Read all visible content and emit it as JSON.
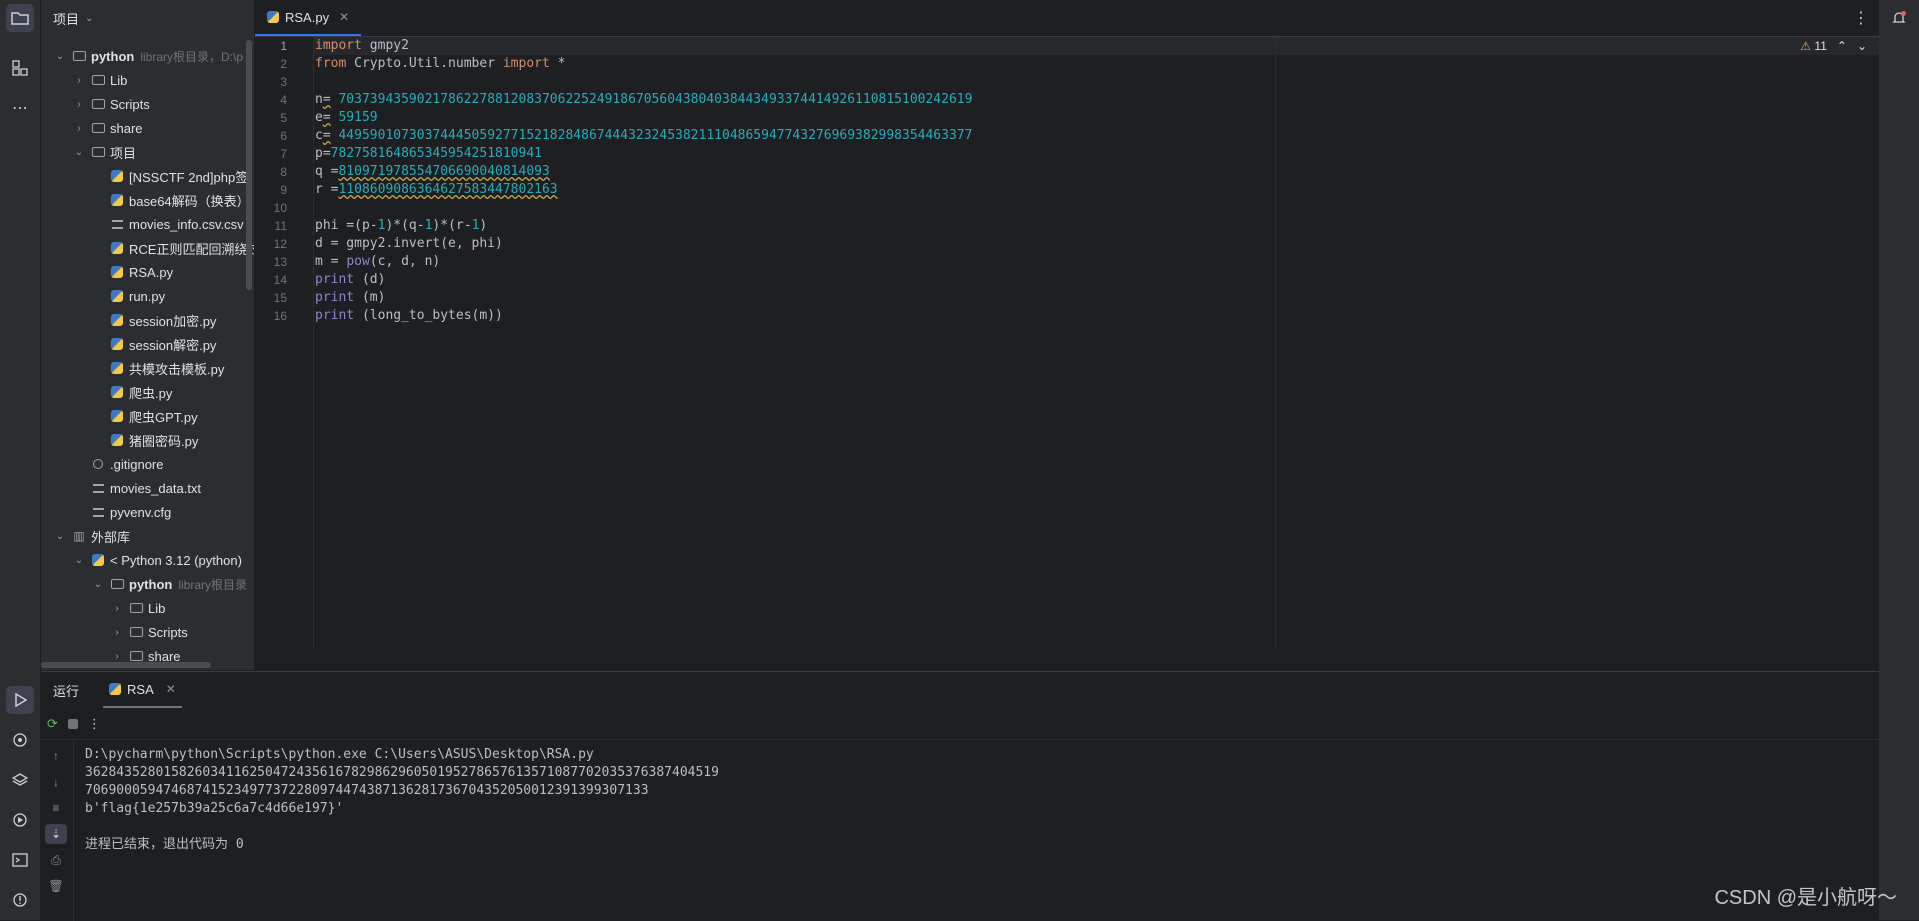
{
  "project_panel": {
    "title": "项目",
    "tree": [
      {
        "label": "python",
        "hint": "library根目录，D:\\p",
        "icon": "folder-icon",
        "arrow": "⌄",
        "bold": true
      },
      {
        "label": "Lib",
        "icon": "folder-icon",
        "arrow": "›"
      },
      {
        "label": "Scripts",
        "icon": "folder-icon",
        "arrow": "›"
      },
      {
        "label": "share",
        "icon": "folder-icon",
        "arrow": "›"
      },
      {
        "label": "项目",
        "icon": "folder-icon",
        "arrow": "⌄"
      },
      {
        "label": "[NSSCTF 2nd]php签",
        "icon": "python-file-icon"
      },
      {
        "label": "base64解码（换表）",
        "icon": "python-file-icon"
      },
      {
        "label": "movies_info.csv.csv",
        "icon": "text-file-icon"
      },
      {
        "label": "RCE正则匹配回溯绕过",
        "icon": "python-file-icon"
      },
      {
        "label": "RSA.py",
        "icon": "python-file-icon"
      },
      {
        "label": "run.py",
        "icon": "python-file-icon"
      },
      {
        "label": "session加密.py",
        "icon": "python-file-icon"
      },
      {
        "label": "session解密.py",
        "icon": "python-file-icon"
      },
      {
        "label": "共模攻击模板.py",
        "icon": "python-file-icon"
      },
      {
        "label": "爬虫.py",
        "icon": "python-file-icon"
      },
      {
        "label": "爬虫GPT.py",
        "icon": "python-file-icon"
      },
      {
        "label": "猪圈密码.py",
        "icon": "python-file-icon"
      },
      {
        "label": ".gitignore",
        "icon": "ignore-file-icon"
      },
      {
        "label": "movies_data.txt",
        "icon": "text-file-icon"
      },
      {
        "label": "pyvenv.cfg",
        "icon": "text-file-icon"
      },
      {
        "label": "外部库",
        "icon": "library-icon",
        "arrow": "⌄"
      },
      {
        "label": "< Python 3.12 (python)",
        "icon": "python-file-icon",
        "arrow": "⌄"
      },
      {
        "label": "python",
        "hint": "library根目录",
        "icon": "folder-icon",
        "arrow": "⌄",
        "bold": true
      },
      {
        "label": "Lib",
        "icon": "folder-icon",
        "arrow": "›"
      },
      {
        "label": "Scripts",
        "icon": "folder-icon",
        "arrow": "›"
      },
      {
        "label": "share",
        "icon": "folder-icon",
        "arrow": "›"
      }
    ]
  },
  "editor": {
    "tab_label": "RSA.py",
    "warning_count": "11",
    "line_numbers": [
      "1",
      "2",
      "3",
      "4",
      "5",
      "6",
      "7",
      "8",
      "9",
      "10",
      "11",
      "12",
      "13",
      "14",
      "15",
      "16"
    ],
    "code_lines": [
      "import gmpy2",
      "from Crypto.Util.number import *",
      "",
      "n= 70373943590217862278812083706225249186705604380403844349337441492611081510024 2619",
      "e= 59159",
      "c= 44959010730374445059277152182848674443232453821110486594774327696938299835446 3377",
      "p=78275816486534595425181094 1",
      "q =81097197855470669004081409 3",
      "r =11086090863646275834478021 63",
      "",
      "phi =(p-1)*(q-1)*(r-1)",
      "d = gmpy2.invert(e, phi)",
      "m = pow(c, d, n)",
      "print (d)",
      "print (m)",
      "print (long_to_bytes(m))"
    ],
    "values": {
      "n": "703739435902178622788120837062252491867056043804038443493374414926110815100242619",
      "e": "59159",
      "c": "449590107303744450592771521828486744432324538211104865947743276969382998354463377",
      "p": "782758164865345954251810941",
      "q": "810971978554706690040814093",
      "r": "1108609086364627583447802163"
    }
  },
  "run_panel": {
    "title": "运行",
    "tab_label": "RSA",
    "console": [
      "D:\\pycharm\\python\\Scripts\\python.exe C:\\Users\\ASUS\\Desktop\\RSA.py",
      "362843528015826034116250472435616782986296050195278657613571087702035376387404519",
      "706900059474687415234977372280974474387136281736704352050012391399307133",
      "b'flag{1e257b39a25c6a7c4d66e197}'",
      "",
      "进程已结束，退出代码为 0"
    ]
  },
  "watermark": "CSDN @是小航呀～"
}
